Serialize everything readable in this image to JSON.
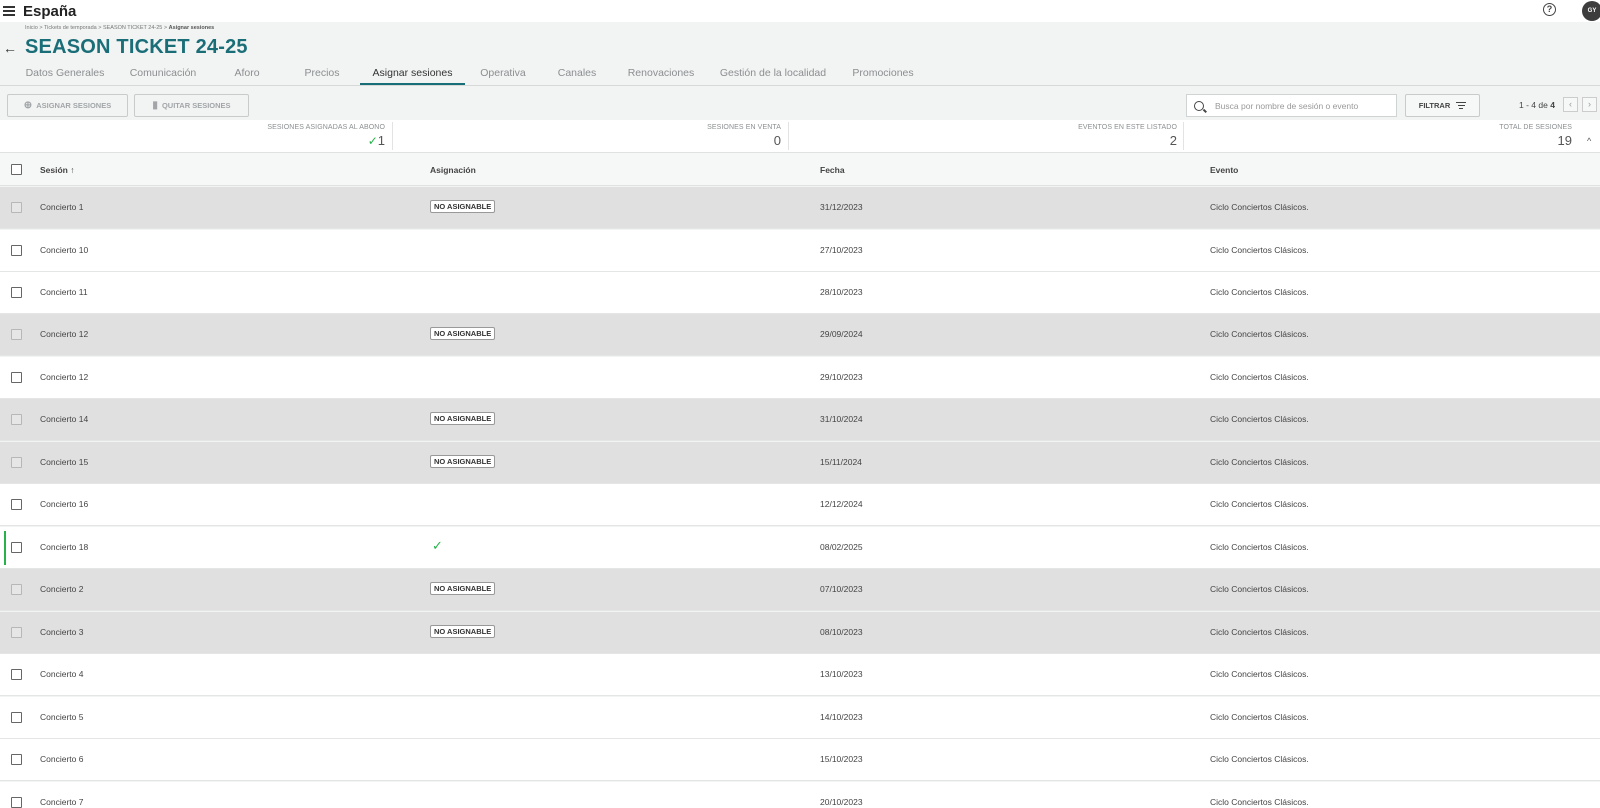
{
  "app": {
    "title": "España",
    "avatar_initials": "GY",
    "help_icon": "?"
  },
  "breadcrumb": {
    "parts": "Inicio > Tickets de temporada > SEASON TICKET 24-25 > ",
    "current": "Asignar sesiones"
  },
  "page": {
    "title": "SEASON TICKET 24-25"
  },
  "tabs": [
    {
      "label": "Datos Generales"
    },
    {
      "label": "Comunicación"
    },
    {
      "label": "Aforo"
    },
    {
      "label": "Precios"
    },
    {
      "label": "Asignar sesiones",
      "active": true
    },
    {
      "label": "Operativa"
    },
    {
      "label": "Canales"
    },
    {
      "label": "Renovaciones"
    },
    {
      "label": "Gestión de la localidad"
    },
    {
      "label": "Promociones"
    }
  ],
  "toolbar": {
    "assign_label": "ASIGNAR SESIONES",
    "remove_label": "QUITAR SESIONES",
    "search_placeholder": "Busca por nombre de sesión o evento",
    "filter_label": "FILTRAR",
    "pagination_range": "1 - 4 de ",
    "pagination_total": "4"
  },
  "stats": {
    "assigned": {
      "label": "SESIONES ASIGNADAS AL ABONO",
      "value": "1"
    },
    "on_sale": {
      "label": "SESIONES EN VENTA",
      "value": "0"
    },
    "events": {
      "label": "EVENTOS EN ESTE LISTADO",
      "value": "2"
    },
    "total": {
      "label": "TOTAL DE SESIONES",
      "value": "19"
    }
  },
  "table": {
    "headers": {
      "session": "Sesión",
      "session_sort": "↑",
      "assignment": "Asignación",
      "date": "Fecha",
      "event": "Evento"
    },
    "rows": [
      {
        "session": "Concierto 1",
        "assignment": "NO ASIGNABLE",
        "date": "31/12/2023",
        "event": "Ciclo Conciertos Clásicos."
      },
      {
        "session": "Concierto 10",
        "assignment": "",
        "date": "27/10/2023",
        "event": "Ciclo Conciertos Clásicos."
      },
      {
        "session": "Concierto 11",
        "assignment": "",
        "date": "28/10/2023",
        "event": "Ciclo Conciertos Clásicos."
      },
      {
        "session": "Concierto 12",
        "assignment": "NO ASIGNABLE",
        "date": "29/09/2024",
        "event": "Ciclo Conciertos Clásicos."
      },
      {
        "session": "Concierto 12",
        "assignment": "",
        "date": "29/10/2023",
        "event": "Ciclo Conciertos Clásicos."
      },
      {
        "session": "Concierto 14",
        "assignment": "NO ASIGNABLE",
        "date": "31/10/2024",
        "event": "Ciclo Conciertos Clásicos."
      },
      {
        "session": "Concierto 15",
        "assignment": "NO ASIGNABLE",
        "date": "15/11/2024",
        "event": "Ciclo Conciertos Clásicos."
      },
      {
        "session": "Concierto 16",
        "assignment": "",
        "date": "12/12/2024",
        "event": "Ciclo Conciertos Clásicos."
      },
      {
        "session": "Concierto 18",
        "assignment": "✓",
        "date": "08/02/2025",
        "event": "Ciclo Conciertos Clásicos."
      },
      {
        "session": "Concierto 2",
        "assignment": "NO ASIGNABLE",
        "date": "07/10/2023",
        "event": "Ciclo Conciertos Clásicos."
      },
      {
        "session": "Concierto 3",
        "assignment": "NO ASIGNABLE",
        "date": "08/10/2023",
        "event": "Ciclo Conciertos Clásicos."
      },
      {
        "session": "Concierto 4",
        "assignment": "",
        "date": "13/10/2023",
        "event": "Ciclo Conciertos Clásicos."
      },
      {
        "session": "Concierto 5",
        "assignment": "",
        "date": "14/10/2023",
        "event": "Ciclo Conciertos Clásicos."
      },
      {
        "session": "Concierto 6",
        "assignment": "",
        "date": "15/10/2023",
        "event": "Ciclo Conciertos Clásicos."
      },
      {
        "session": "Concierto 7",
        "assignment": "",
        "date": "20/10/2023",
        "event": "Ciclo Conciertos Clásicos."
      }
    ]
  },
  "colors": {
    "accent": "#1a6e78",
    "success": "#27b24b",
    "disabled_row": "#e0e0e0"
  }
}
